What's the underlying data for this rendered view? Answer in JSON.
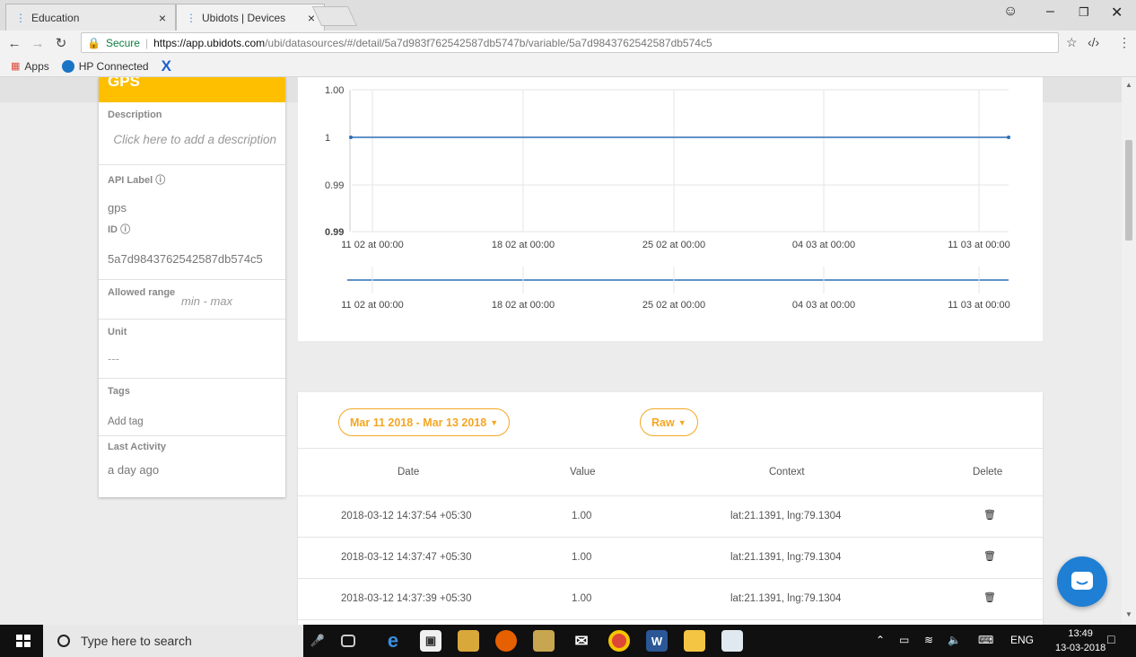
{
  "browser": {
    "tabs": [
      {
        "title": "Education",
        "close": "×"
      },
      {
        "title": "Ubidots | Devices",
        "close": "×"
      }
    ],
    "secure_label": "Secure",
    "url_host": "https://app.ubidots.com",
    "url_path": "/ubi/datasources/#/detail/5a7d983f762542587db5747b/variable/5a7d9843762542587db574c5",
    "bookmarks": [
      {
        "label": "Apps"
      },
      {
        "label": "HP Connected"
      }
    ]
  },
  "sidebar": {
    "title": "GPS",
    "description_label": "Description",
    "description_placeholder": "Click here to add a description",
    "api_label_label": "API Label",
    "api_label_value": "gps",
    "id_label": "ID",
    "id_value": "5a7d9843762542587db574c5",
    "allowed_range_label": "Allowed range",
    "allowed_range_value": "min - max",
    "unit_label": "Unit",
    "unit_value": "---",
    "tags_label": "Tags",
    "tags_add": "Add tag",
    "last_activity_label": "Last Activity",
    "last_activity_value": "a day ago"
  },
  "chart_data": {
    "type": "line",
    "title": "",
    "xlabel": "",
    "ylabel": "",
    "y_ticks": [
      "1.00",
      "1",
      "0.99",
      "0.99"
    ],
    "x_ticks": [
      "11 02 at 00:00",
      "18 02 at 00:00",
      "25 02 at 00:00",
      "04 03 at 00:00",
      "11 03 at 00:00"
    ],
    "navigator_x_ticks": [
      "11 02 at 00:00",
      "18 02 at 00:00",
      "25 02 at 00:00",
      "04 03 at 00:00",
      "11 03 at 00:00"
    ],
    "series": [
      {
        "x": [
          "11 02",
          "13 03"
        ],
        "values": [
          1,
          1
        ]
      }
    ],
    "grid": true,
    "colors": {
      "line": "#2c6fb5"
    }
  },
  "table": {
    "date_range_label": "Mar 11 2018 - Mar 13 2018",
    "mode_label": "Raw",
    "columns": [
      "Date",
      "Value",
      "Context",
      "Delete"
    ],
    "rows": [
      {
        "date": "2018-03-12 14:37:54 +05:30",
        "value": "1.00",
        "context": "lat:21.1391, lng:79.1304"
      },
      {
        "date": "2018-03-12 14:37:47 +05:30",
        "value": "1.00",
        "context": "lat:21.1391, lng:79.1304"
      },
      {
        "date": "2018-03-12 14:37:39 +05:30",
        "value": "1.00",
        "context": "lat:21.1391, lng:79.1304"
      }
    ]
  },
  "taskbar": {
    "search_placeholder": "Type here to search",
    "language": "ENG",
    "time": "13:49",
    "date": "13-03-2018"
  },
  "colors": {
    "accent": "#f5a623",
    "gps_header": "#fdbf00",
    "chat": "#1f7fd4"
  }
}
